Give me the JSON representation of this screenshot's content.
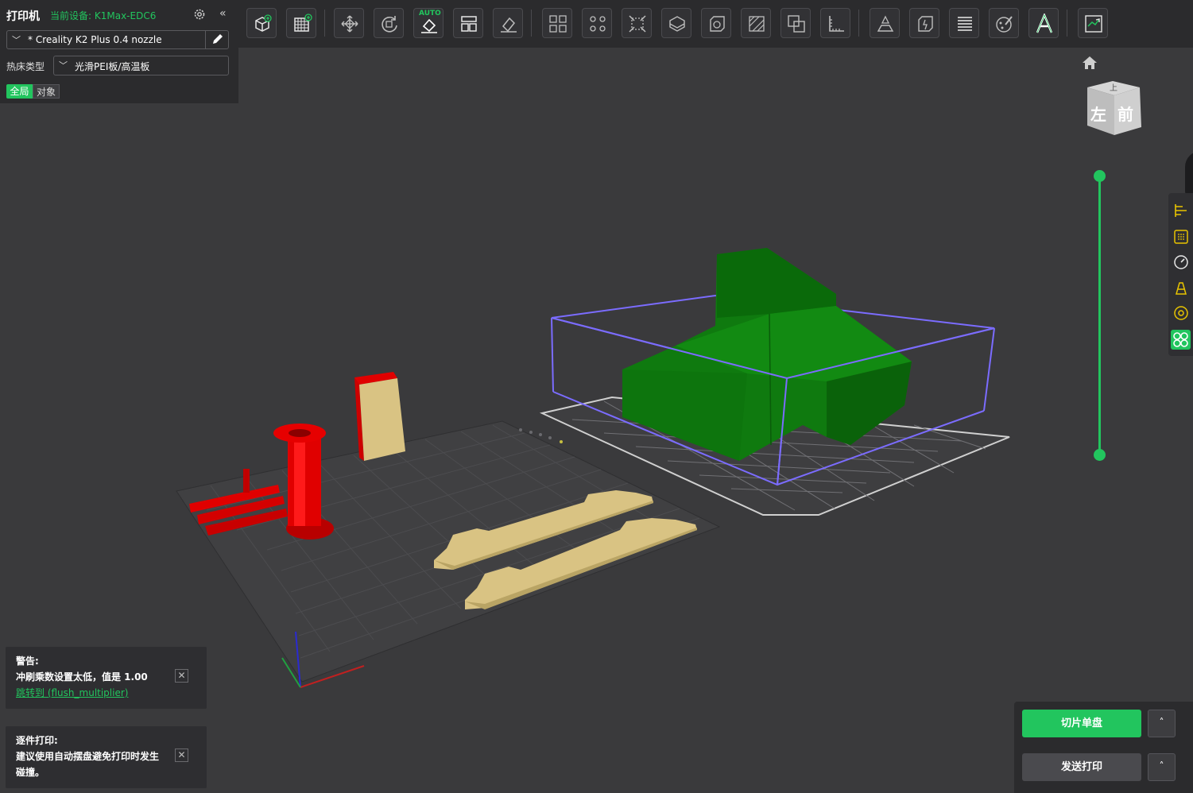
{
  "printer_panel": {
    "title": "打印机",
    "current_device": "当前设备: K1Max-EDC6",
    "preset": "* Creality K2 Plus 0.4 nozzle",
    "bed_type_label": "热床类型",
    "bed_type_value": "光滑PEI板/高温板",
    "tab_global": "全局",
    "tab_object": "对象",
    "collapse_glyph": "«"
  },
  "toolbar": {
    "auto_label": "AUTO",
    "icons": [
      "add-object-icon",
      "plate-grid-icon",
      "move-icon",
      "rotate-icon",
      "auto-orient-icon",
      "arrange-icon",
      "lay-on-face-icon",
      "split-objects-icon",
      "split-parts-icon",
      "scale-icon",
      "cut-icon",
      "hollow-icon",
      "support-paint-icon",
      "boolean-icon",
      "measure-icon",
      "emboss-icon",
      "seam-paint-icon",
      "variable-layer-icon",
      "color-paint-icon",
      "text-icon",
      "preview-icon"
    ]
  },
  "view_cube": {
    "face_left": "左",
    "face_front": "前",
    "face_top": "上"
  },
  "notices": [
    {
      "title": "警告:",
      "body": "冲刷乘数设置太低，值是 1.00",
      "link": "跳转到 (flush_multiplier)"
    },
    {
      "title": "逐件打印:",
      "body_line1": "建议使用自动摆盘避免打印时发生",
      "body_line2": "碰撞。"
    }
  ],
  "actions": {
    "slice_plate": "切片单盘",
    "send_print": "发送打印",
    "caret": "˄"
  },
  "colors": {
    "accent": "#22c55e",
    "model_green": "#0f7a0f",
    "model_red": "#e00000",
    "model_tan": "#d9c383",
    "bbox_blue": "#7b6cff"
  }
}
